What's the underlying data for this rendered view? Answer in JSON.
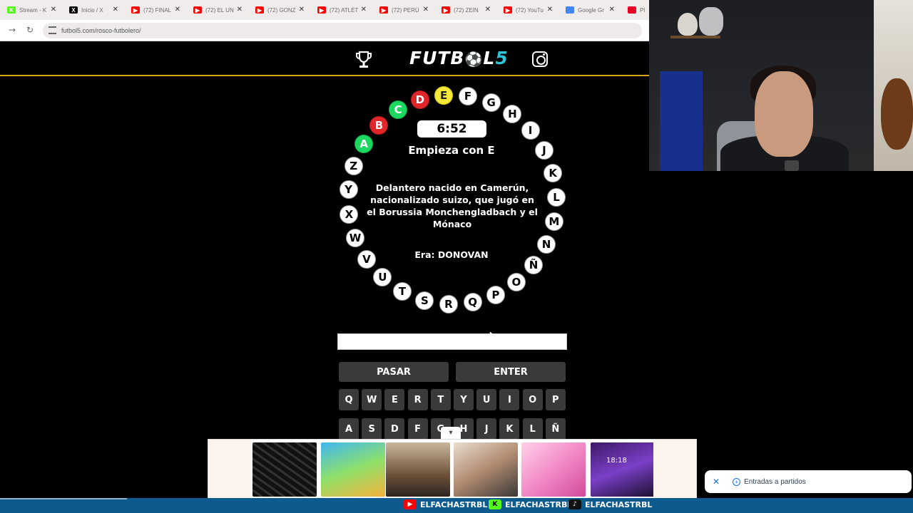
{
  "browser": {
    "tabs": [
      {
        "label": "Stream - K",
        "icon": "kick-icon",
        "color": "#53fc18"
      },
      {
        "label": "Inicio / X",
        "icon": "x-icon",
        "color": "#000000"
      },
      {
        "label": "(72) FINAL",
        "icon": "youtube-icon",
        "color": "#ff0000"
      },
      {
        "label": "(72) EL UN",
        "icon": "youtube-icon",
        "color": "#ff0000"
      },
      {
        "label": "(72) GONZ",
        "icon": "youtube-icon",
        "color": "#ff0000"
      },
      {
        "label": "(72) ATLÉT",
        "icon": "youtube-icon",
        "color": "#ff0000"
      },
      {
        "label": "(72) PERÚ",
        "icon": "youtube-icon",
        "color": "#ff0000"
      },
      {
        "label": "(72) ZEIN",
        "icon": "youtube-icon",
        "color": "#ff0000"
      },
      {
        "label": "(72) YouTu",
        "icon": "youtube-icon",
        "color": "#ff0000"
      },
      {
        "label": "Google Gr",
        "icon": "google-icon",
        "color": "#4285f4"
      },
      {
        "label": "Pl",
        "icon": "pinterest-icon",
        "color": "#e60023"
      }
    ],
    "url": "futbol5.com/rosco-futbolero/"
  },
  "header": {
    "logo_main": "FUTB",
    "logo_ball": "⚽",
    "logo_l": "L",
    "logo_five": "5",
    "accent": "#d8a21a"
  },
  "rosco": {
    "letters": [
      {
        "l": "A",
        "state": "green"
      },
      {
        "l": "B",
        "state": "red"
      },
      {
        "l": "C",
        "state": "green"
      },
      {
        "l": "D",
        "state": "red"
      },
      {
        "l": "E",
        "state": "yellow"
      },
      {
        "l": "F",
        "state": "pending"
      },
      {
        "l": "G",
        "state": "pending"
      },
      {
        "l": "H",
        "state": "pending"
      },
      {
        "l": "I",
        "state": "pending"
      },
      {
        "l": "J",
        "state": "pending"
      },
      {
        "l": "K",
        "state": "pending"
      },
      {
        "l": "L",
        "state": "pending"
      },
      {
        "l": "M",
        "state": "pending"
      },
      {
        "l": "N",
        "state": "pending"
      },
      {
        "l": "Ñ",
        "state": "pending"
      },
      {
        "l": "O",
        "state": "pending"
      },
      {
        "l": "P",
        "state": "pending"
      },
      {
        "l": "Q",
        "state": "pending"
      },
      {
        "l": "R",
        "state": "pending"
      },
      {
        "l": "S",
        "state": "pending"
      },
      {
        "l": "T",
        "state": "pending"
      },
      {
        "l": "U",
        "state": "pending"
      },
      {
        "l": "V",
        "state": "pending"
      },
      {
        "l": "W",
        "state": "pending"
      },
      {
        "l": "X",
        "state": "pending"
      },
      {
        "l": "Y",
        "state": "pending"
      },
      {
        "l": "Z",
        "state": "pending"
      }
    ],
    "timer": "6:52",
    "starts_with": "Empieza con E",
    "clue": "Delantero nacido en Camerún, nacionalizado suizo, que jugó en el Borussia Monchengladbach y el Mónaco",
    "hint": "Era: DONOVAN",
    "colors": {
      "correct": "#1ed760",
      "wrong": "#e0252b",
      "current": "#f4e83a"
    }
  },
  "controls": {
    "answer_value": "",
    "pass_label": "PASAR",
    "enter_label": "ENTER"
  },
  "keyboard": {
    "row1": [
      "Q",
      "W",
      "E",
      "R",
      "T",
      "Y",
      "U",
      "I",
      "O",
      "P"
    ],
    "row2": [
      "A",
      "S",
      "D",
      "F",
      "G",
      "H",
      "J",
      "K",
      "L",
      "Ñ"
    ]
  },
  "ads": {
    "phone_time": "18:18"
  },
  "popup": {
    "label": "Entradas a partidos"
  },
  "footer": {
    "handles": [
      {
        "platform": "youtube-icon",
        "handle": "ELFACHASTRBL",
        "color": "#ff0000"
      },
      {
        "platform": "kick-icon",
        "handle": "ELFACHASTRBL",
        "color": "#53fc18"
      },
      {
        "platform": "tiktok-icon",
        "handle": "ELFACHASTRBL",
        "color": "#111111"
      }
    ]
  }
}
